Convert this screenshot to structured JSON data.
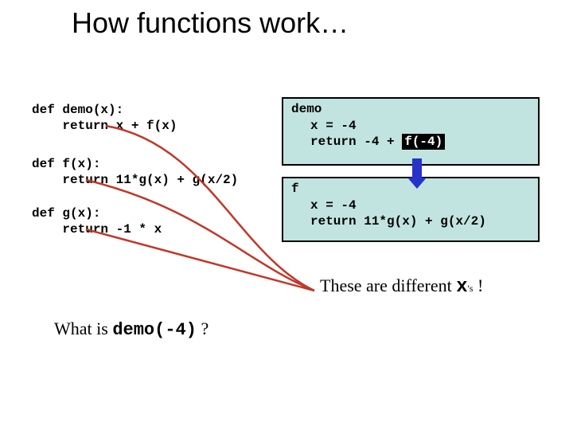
{
  "title": "How functions work…",
  "left_code": {
    "demo": "def demo(x):\n    return x + f(x)",
    "f": "def f(x):\n    return 11*g(x) + g(x/2)",
    "g": "def g(x):\n    return -1 * x"
  },
  "question": {
    "prefix": "What is  ",
    "call": "demo(-4)",
    "suffix": "  ?"
  },
  "trace": {
    "demo": {
      "head": "demo",
      "line1": "x = -4",
      "line2_prefix": "return -4 + ",
      "line2_call": "f(-4)"
    },
    "f": {
      "head": "f",
      "line1": "x = -4",
      "line2": "return 11*g(x) + g(x/2)"
    }
  },
  "footnote": {
    "pre": "These are different ",
    "x": "x",
    "sub": "'s",
    "post": " !"
  },
  "icons": {
    "downarrow": "down-arrow-icon"
  },
  "colors": {
    "box_fill": "#c2e4e1",
    "arrow": "#2732c9",
    "curve": "#c03828",
    "highlight_bg": "#000000",
    "highlight_fg": "#ffffff"
  }
}
